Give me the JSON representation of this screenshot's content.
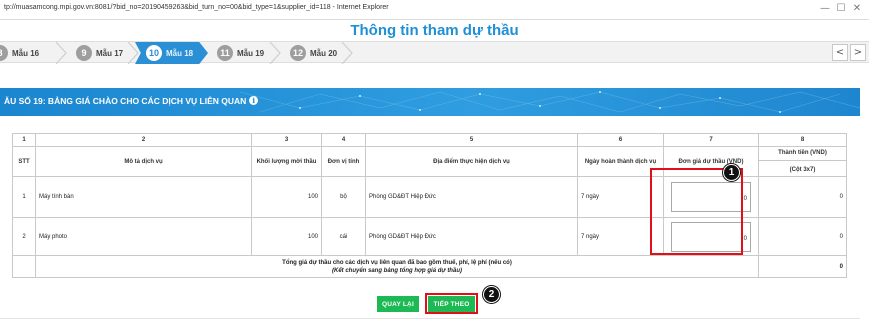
{
  "browser": {
    "url_title": "tp://muasamcong.mpi.gov.vn:8081/?bid_no=20190459263&bid_turn_no=00&bid_type=1&supplier_id=118 - Internet Explorer",
    "min_glyph": "—",
    "max_glyph": "☐",
    "close_glyph": "✕"
  },
  "page": {
    "title": "Thông tin tham dự thầu"
  },
  "steps": [
    {
      "num": "8",
      "label": "Mẫu 16"
    },
    {
      "num": "9",
      "label": "Mẫu 17"
    },
    {
      "num": "10",
      "label": "Mẫu 18"
    },
    {
      "num": "11",
      "label": "Mẫu 19"
    },
    {
      "num": "12",
      "label": "Mẫu 20"
    }
  ],
  "nav": {
    "prev": "<",
    "next": ">"
  },
  "form": {
    "title": "ẪU SỐ 19: BẢNG GIÁ CHÀO CHO CÁC DỊCH VỤ LIÊN QUAN",
    "info_glyph": "i"
  },
  "table": {
    "col_numbers": [
      "1",
      "2",
      "3",
      "4",
      "5",
      "6",
      "7",
      "8"
    ],
    "headers": {
      "stt": "STT",
      "service": "Mô tả dịch vụ",
      "quantity": "Khối lượng mời thầu",
      "unit": "Đơn vị tính",
      "location": "Địa điểm thực hiện dịch vụ",
      "completion": "Ngày hoàn thành dịch vụ",
      "unit_price": "Đơn giá dự thầu (VND)",
      "total": "Thành tiền (VND)",
      "total_sub": "(Cột 3x7)"
    },
    "rows": [
      {
        "stt": "1",
        "service": "Máy tính bàn",
        "quantity": "100",
        "unit": "bộ",
        "location": "Phòng GD&ĐT Hiệp Đức",
        "completion": "7 ngày",
        "unit_price": "0",
        "total": "0"
      },
      {
        "stt": "2",
        "service": "Máy photo",
        "quantity": "100",
        "unit": "cái",
        "location": "Phòng GD&ĐT Hiệp Đức",
        "completion": "7 ngày",
        "unit_price": "0",
        "total": "0"
      }
    ],
    "summary": {
      "label": "Tổng giá dự thầu cho các dịch vụ liên quan đã bao gồm thuế, phí, lệ phí (nếu có)",
      "note": "(Kết chuyển sang bảng tổng hợp giá dự thầu)",
      "value": "0"
    }
  },
  "buttons": {
    "back": "QUAY LẠI",
    "next": "TIẾP THEO"
  },
  "callouts": {
    "one": "1",
    "two": "2"
  },
  "colors": {
    "accent": "#2a8fd4",
    "highlight": "#e0101a",
    "button": "#1db954"
  }
}
